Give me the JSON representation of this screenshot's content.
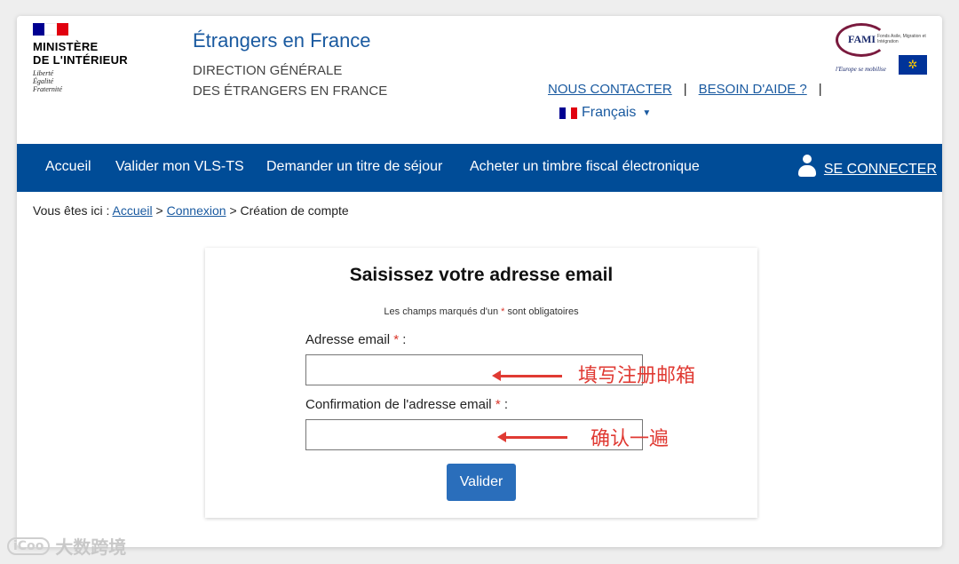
{
  "header": {
    "ministere_line1": "MINISTÈRE",
    "ministere_line2": "DE L'INTÉRIEUR",
    "devise": [
      "Liberté",
      "Égalité",
      "Fraternité"
    ],
    "site_title": "Étrangers en France",
    "site_subtitle_line1": "DIRECTION GÉNÉRALE",
    "site_subtitle_line2": "DES ÉTRANGERS EN FRANCE",
    "contact_link": "NOUS CONTACTER",
    "help_link": "BESOIN D'AIDE ?",
    "separator": "|",
    "language": "Français",
    "fami_logo_text": "FAMI",
    "fami_small_text": "Fonds Asile, Migration et Intégration",
    "eu_tagline": "l'Europe se mobilise"
  },
  "nav": {
    "items": [
      "Accueil",
      "Valider mon VLS-TS",
      "Demander un titre de séjour",
      "Acheter un timbre fiscal électronique"
    ],
    "connect_label": "SE CONNECTER"
  },
  "breadcrumb": {
    "prefix": "Vous êtes ici :",
    "home": "Accueil",
    "sep": ">",
    "connexion": "Connexion",
    "current": "Création de compte"
  },
  "form": {
    "title": "Saisissez votre adresse email",
    "required_note_before": "Les champs marqués d'un",
    "required_star": "*",
    "required_note_after": "sont obligatoires",
    "email_label": "Adresse email",
    "email_confirm_label": "Confirmation de l'adresse email",
    "label_suffix": ":",
    "email_value": "",
    "email_confirm_value": "",
    "submit_label": "Valider"
  },
  "annotations": {
    "email_note": "填写注册邮箱",
    "confirm_note": "确认一遍"
  },
  "watermark": {
    "logo": "iCoo",
    "text": "大数跨境"
  },
  "colors": {
    "nav_bg": "#004c97",
    "link": "#1a5aa0",
    "button": "#2a6ebb",
    "annotation": "#e03a33"
  }
}
